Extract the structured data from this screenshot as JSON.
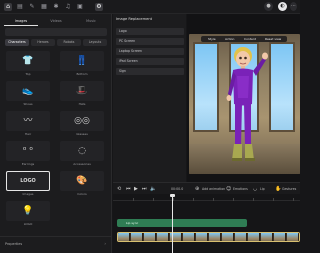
{
  "left_panel": {
    "tabs": [
      {
        "label": "Images"
      },
      {
        "label": "Videos"
      },
      {
        "label": "Music"
      }
    ],
    "chips": [
      {
        "label": "Characters"
      },
      {
        "label": "Heroes"
      },
      {
        "label": "Robots"
      },
      {
        "label": "Layouts"
      }
    ],
    "items": [
      {
        "label": "Top",
        "icon": "shirt-icon"
      },
      {
        "label": "Bottom",
        "icon": "pants-icon"
      },
      {
        "label": "Shoes",
        "icon": "shoe-icon"
      },
      {
        "label": "Hats",
        "icon": "hat-icon"
      },
      {
        "label": "Hair",
        "icon": "hair-icon"
      },
      {
        "label": "Glasses",
        "icon": "glasses-icon"
      },
      {
        "label": "Earrings",
        "icon": "earrings-icon"
      },
      {
        "label": "Accessories",
        "icon": "accessories-icon"
      },
      {
        "label": "Images",
        "icon": "logo-icon",
        "glyph": "LOGO"
      },
      {
        "label": "Colors",
        "icon": "palette-icon"
      },
      {
        "label": "LOGO",
        "icon": "lightbulb-icon"
      }
    ],
    "properties_label": "Properties"
  },
  "middle_panel": {
    "title": "Image Replacement",
    "rows": [
      {
        "label": "Logo"
      },
      {
        "label": "PC Screen"
      },
      {
        "label": "Laptop Screen"
      },
      {
        "label": "iPad Screen"
      },
      {
        "label": "Sign"
      }
    ]
  },
  "preview": {
    "overlay": [
      {
        "label": "Style"
      },
      {
        "label": "Action"
      },
      {
        "label": "Content"
      },
      {
        "label": "Reset view"
      }
    ]
  },
  "transport": {
    "time": "00:00.0",
    "buttons": [
      {
        "label": "Add animation"
      },
      {
        "label": "Emotions"
      },
      {
        "label": "Lip"
      },
      {
        "label": "Gestures"
      }
    ]
  },
  "timeline": {
    "clip_label": "Lip sync"
  },
  "colors": {
    "background": "#161618",
    "panel": "#1c1c1e",
    "clip": "#2f7d54",
    "strip_border": "#d8c070",
    "suit": "#7a22b8"
  }
}
